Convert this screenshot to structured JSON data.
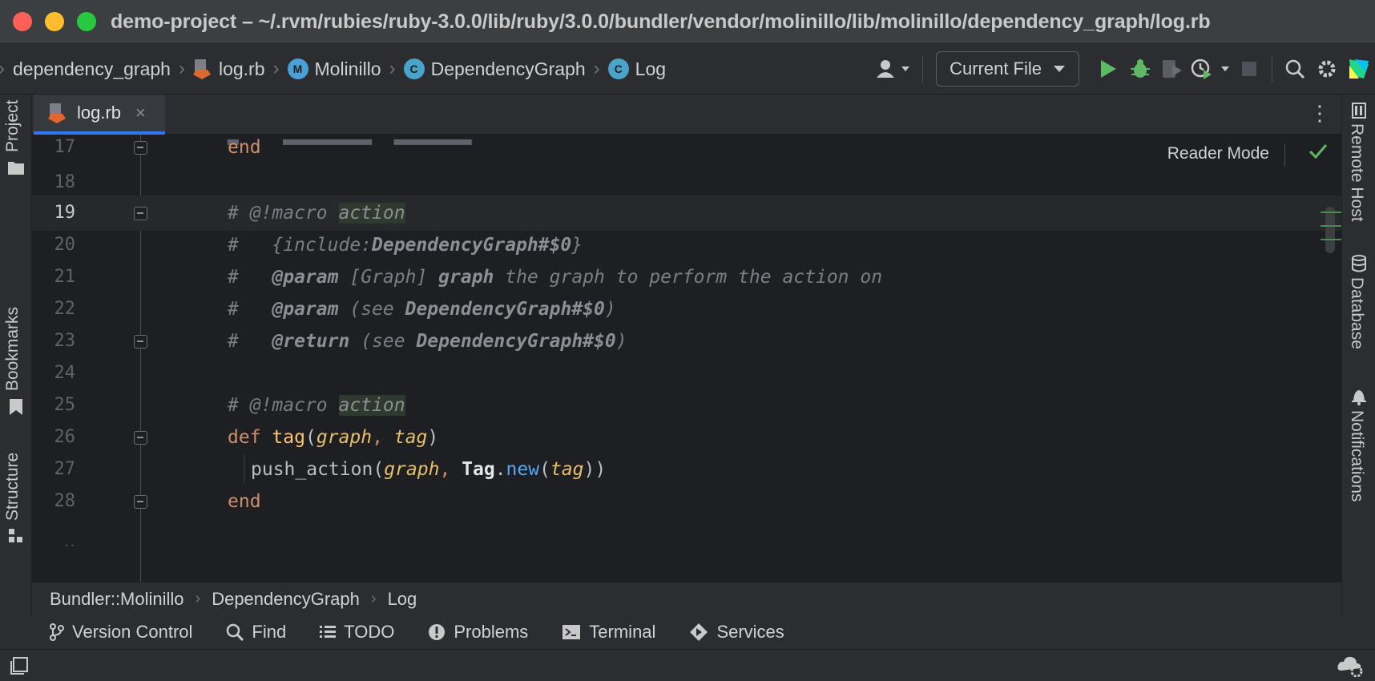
{
  "window": {
    "title": "demo-project – ~/.rvm/rubies/ruby-3.0.0/lib/ruby/3.0.0/bundler/vendor/molinillo/lib/molinillo/dependency_graph/log.rb"
  },
  "navbar": {
    "crumbs": [
      "dependency_graph",
      "log.rb",
      "Molinillo",
      "DependencyGraph",
      "Log"
    ],
    "module_badge": "M",
    "class_badge": "C",
    "run_config": "Current File"
  },
  "tabs": [
    {
      "label": "log.rb",
      "close": "×"
    }
  ],
  "left_tools": {
    "project": "Project",
    "bookmarks": "Bookmarks",
    "structure": "Structure"
  },
  "right_tools": {
    "remote_host": "Remote Host",
    "database": "Database",
    "notifications": "Notifications"
  },
  "editor": {
    "reader_mode": "Reader Mode",
    "line_numbers": [
      "17",
      "18",
      "19",
      "20",
      "21",
      "22",
      "23",
      "24",
      "25",
      "26",
      "27",
      "28"
    ],
    "current_line": "19",
    "code": {
      "l17_end": "end",
      "comment_hash": "#",
      "macro": "@!macro",
      "action": "action",
      "include": "{include:",
      "include_ref": "DependencyGraph#$0",
      "include_close": "}",
      "param_tag": "@param",
      "graph_type": "[Graph]",
      "graph_name": "graph",
      "graph_desc": "the graph to perform the action on",
      "see_open": "(see ",
      "see_ref": "DependencyGraph#$0",
      "see_close": ")",
      "return_tag": "@return",
      "def_kw": "def",
      "method_name": "tag",
      "arg_graph": "graph",
      "arg_tag": "tag",
      "push_action": "push_action",
      "tag_const": "Tag",
      "new_meth": "new",
      "l28_end": "end"
    }
  },
  "bottom_breadcrumb": [
    "Bundler::Molinillo",
    "DependencyGraph",
    "Log"
  ],
  "tool_windows": [
    {
      "label": "Version Control",
      "icon": "branch-icon"
    },
    {
      "label": "Find",
      "icon": "search-icon"
    },
    {
      "label": "TODO",
      "icon": "list-icon"
    },
    {
      "label": "Problems",
      "icon": "warning-icon"
    },
    {
      "label": "Terminal",
      "icon": "terminal-icon"
    },
    {
      "label": "Services",
      "icon": "services-icon"
    }
  ],
  "colors": {
    "accent": "#3574f0",
    "run_green": "#5fb865",
    "keyword": "#cf8e6d",
    "function": "#ffc66d"
  }
}
